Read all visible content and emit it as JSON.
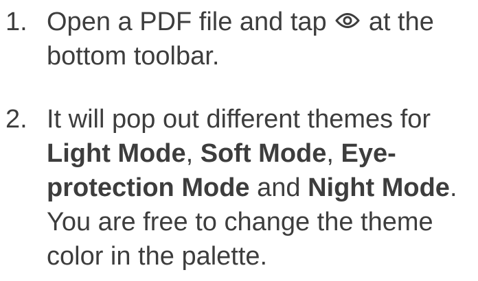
{
  "steps": [
    {
      "number": "1.",
      "text_before_icon": "Open a PDF file and tap",
      "icon": "eye-icon",
      "text_after_icon": "at the bottom toolbar."
    },
    {
      "number": "2.",
      "intro": "It will pop out different themes for",
      "mode_light": "Light Mode",
      "sep_1": ", ",
      "mode_soft": "Soft Mode",
      "sep_2": ", ",
      "mode_eye": "Eye-protection Mode",
      "sep_3": " and ",
      "mode_night": "Night Mode",
      "period": ".",
      "outro": "You are free to change the theme color in the palette."
    }
  ]
}
